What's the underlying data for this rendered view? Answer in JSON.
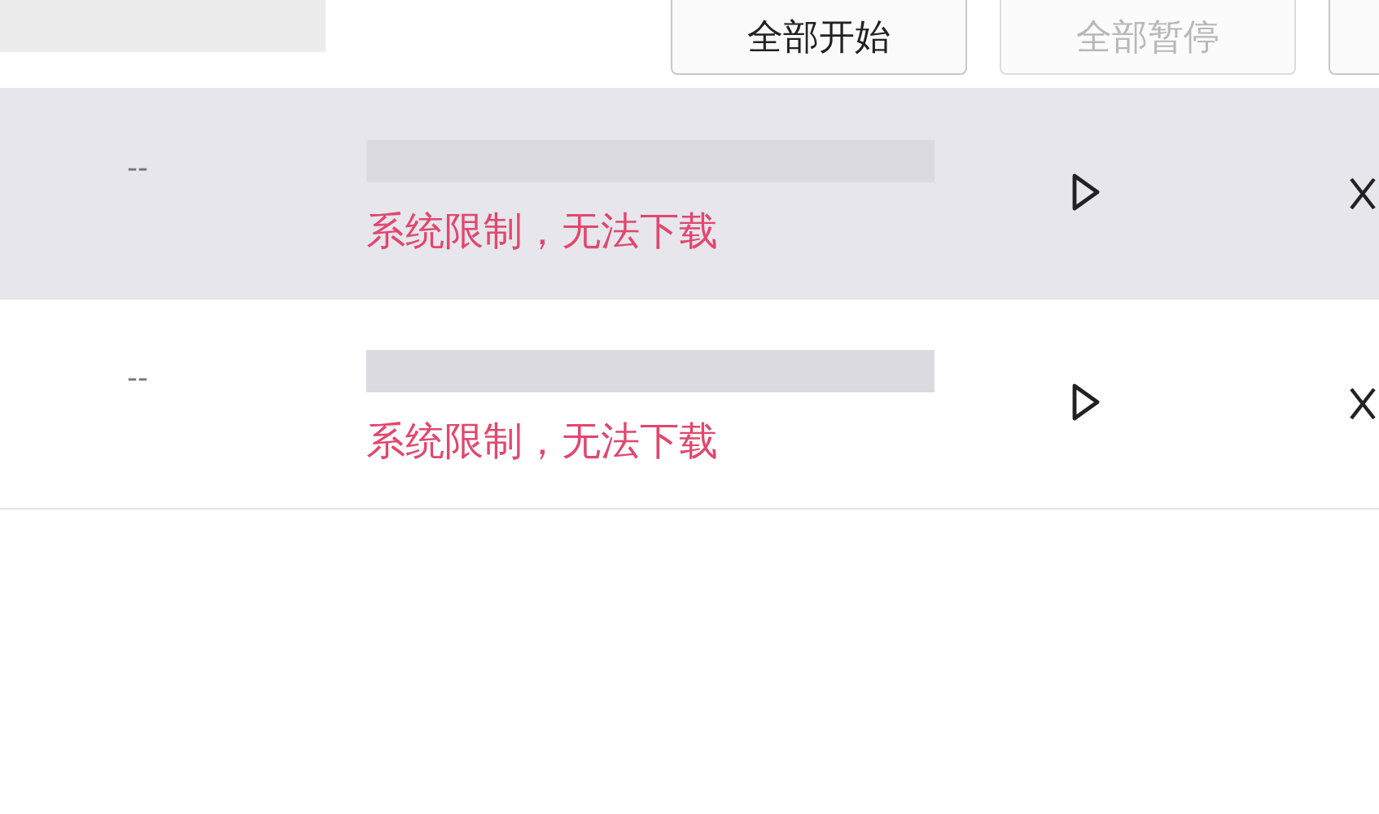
{
  "toolbar": {
    "buttons": [
      {
        "label": "全部开始",
        "disabled": false
      },
      {
        "label": "全部暂停",
        "disabled": true
      }
    ]
  },
  "downloads": [
    {
      "size": "--",
      "error": "系统限制，无法下载",
      "highlighted": true
    },
    {
      "size": "--",
      "error": "系统限制，无法下载",
      "highlighted": false
    }
  ]
}
